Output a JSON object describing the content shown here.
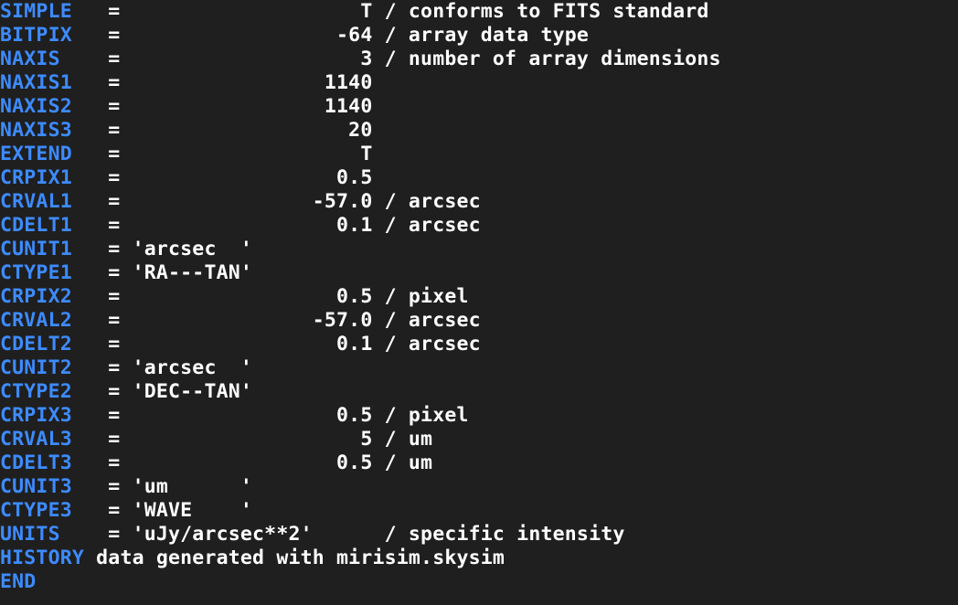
{
  "terminal": {
    "key_color": "#3d8bff",
    "text_color": "#ffffff",
    "background_color": "#1f1f1f",
    "lines": [
      {
        "key": "SIMPLE  ",
        "rest": " =                    T / conforms to FITS standard"
      },
      {
        "key": "BITPIX  ",
        "rest": " =                  -64 / array data type"
      },
      {
        "key": "NAXIS   ",
        "rest": " =                    3 / number of array dimensions"
      },
      {
        "key": "NAXIS1  ",
        "rest": " =                 1140"
      },
      {
        "key": "NAXIS2  ",
        "rest": " =                 1140"
      },
      {
        "key": "NAXIS3  ",
        "rest": " =                   20"
      },
      {
        "key": "EXTEND  ",
        "rest": " =                    T"
      },
      {
        "key": "CRPIX1  ",
        "rest": " =                  0.5"
      },
      {
        "key": "CRVAL1  ",
        "rest": " =                -57.0 / arcsec"
      },
      {
        "key": "CDELT1  ",
        "rest": " =                  0.1 / arcsec"
      },
      {
        "key": "CUNIT1  ",
        "rest": " = 'arcsec  '"
      },
      {
        "key": "CTYPE1  ",
        "rest": " = 'RA---TAN'"
      },
      {
        "key": "CRPIX2  ",
        "rest": " =                  0.5 / pixel"
      },
      {
        "key": "CRVAL2  ",
        "rest": " =                -57.0 / arcsec"
      },
      {
        "key": "CDELT2  ",
        "rest": " =                  0.1 / arcsec"
      },
      {
        "key": "CUNIT2  ",
        "rest": " = 'arcsec  '"
      },
      {
        "key": "CTYPE2  ",
        "rest": " = 'DEC--TAN'"
      },
      {
        "key": "CRPIX3  ",
        "rest": " =                  0.5 / pixel"
      },
      {
        "key": "CRVAL3  ",
        "rest": " =                    5 / um"
      },
      {
        "key": "CDELT3  ",
        "rest": " =                  0.5 / um"
      },
      {
        "key": "CUNIT3  ",
        "rest": " = 'um      '"
      },
      {
        "key": "CTYPE3  ",
        "rest": " = 'WAVE    '"
      },
      {
        "key": "UNITS   ",
        "rest": " = 'uJy/arcsec**2'      / specific intensity"
      },
      {
        "key": "HISTORY",
        "rest": " data generated with mirisim.skysim"
      },
      {
        "key": "END",
        "rest": ""
      }
    ]
  }
}
